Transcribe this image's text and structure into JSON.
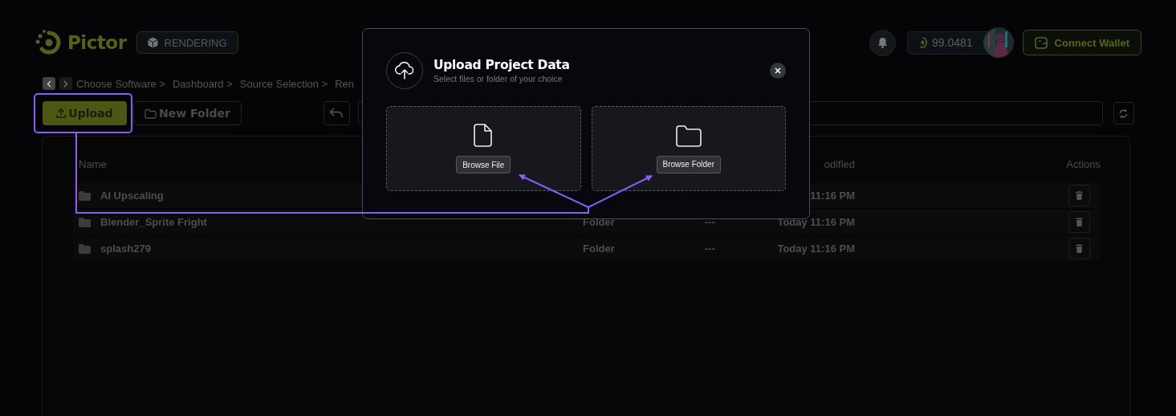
{
  "header": {
    "logo": "Pictor",
    "mode_badge": "RENDERING",
    "balance": "99.0481",
    "connect_button": "Connect Wallet"
  },
  "breadcrumb": [
    "Choose Software >",
    "Dashboard >",
    "Source Selection >",
    "Ren"
  ],
  "toolbar": {
    "upload": "Upload",
    "new_folder": "New Folder"
  },
  "table": {
    "columns": {
      "name": "Name",
      "modified": "odified",
      "actions": "Actions"
    },
    "rows": [
      {
        "name": "AI Upscaling",
        "modified": "11:16 PM"
      },
      {
        "name": "Blender_Sprite Fright",
        "type": "Folder",
        "size": "---",
        "modified": "Today 11:16 PM"
      },
      {
        "name": "splash279",
        "type": "Folder",
        "size": "---",
        "modified": "Today 11:16 PM"
      }
    ]
  },
  "modal": {
    "title": "Upload Project Data",
    "subtitle": "Select files or folder of your choice",
    "options": [
      {
        "kind": "file",
        "button": "Browse File"
      },
      {
        "kind": "folder",
        "button": "Browse Folder"
      }
    ]
  }
}
